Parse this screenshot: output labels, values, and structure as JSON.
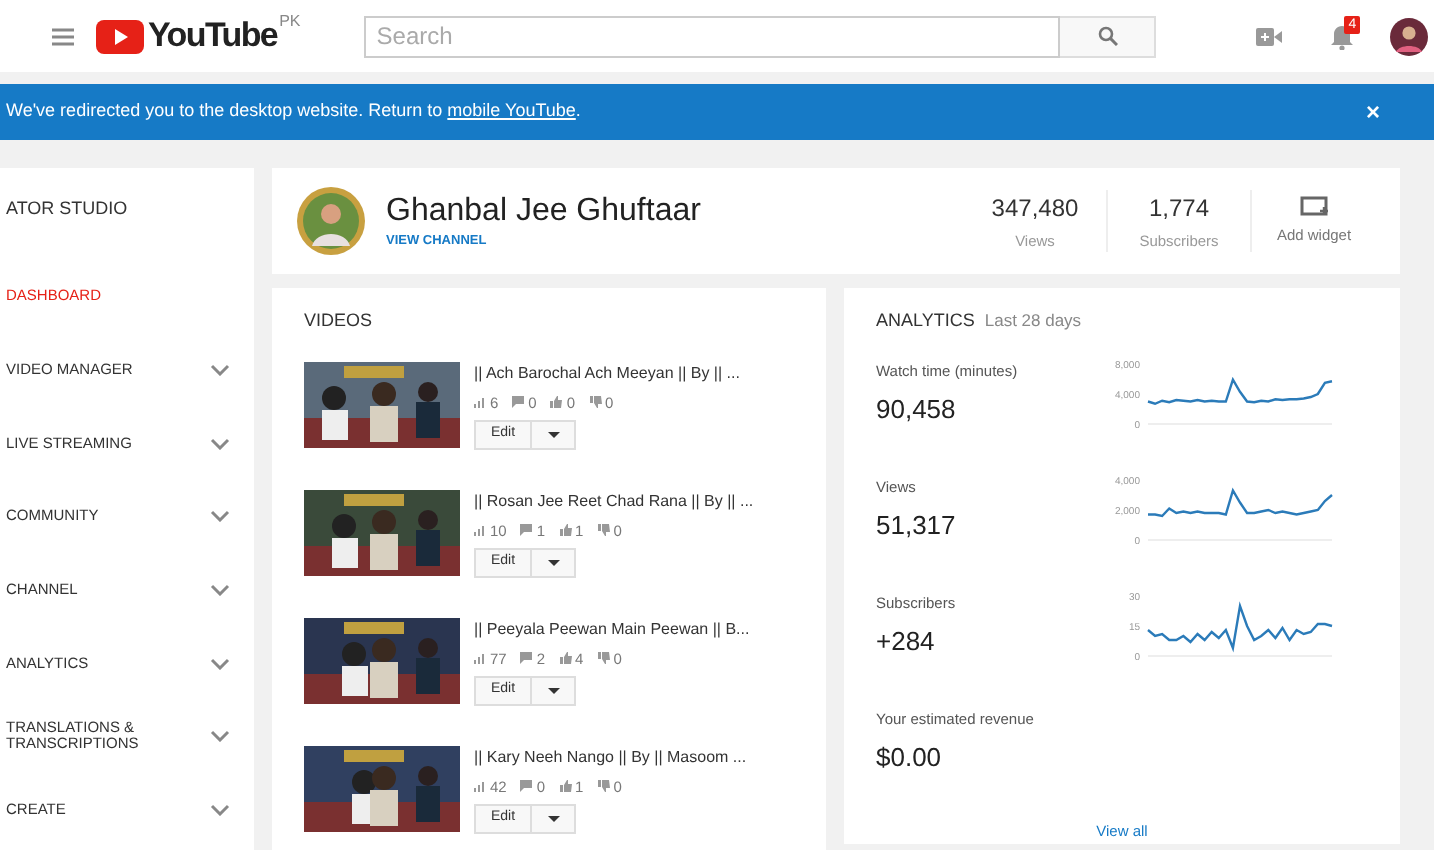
{
  "topbar": {
    "logo": "YouTube",
    "region": "PK",
    "search": {
      "placeholder": "Search"
    },
    "notifications": "4"
  },
  "banner": {
    "text": "We've redirected you to the desktop website. Return to ",
    "link": "mobile YouTube",
    "end": ".",
    "close": "×"
  },
  "sidebar": {
    "title": "ATOR STUDIO",
    "items": [
      {
        "label": "DASHBOARD",
        "selected": true,
        "expandable": false
      },
      {
        "label": "VIDEO MANAGER",
        "selected": false,
        "expandable": true
      },
      {
        "label": "LIVE STREAMING",
        "selected": false,
        "expandable": true
      },
      {
        "label": "COMMUNITY",
        "selected": false,
        "expandable": true
      },
      {
        "label": "CHANNEL",
        "selected": false,
        "expandable": true
      },
      {
        "label": "ANALYTICS",
        "selected": false,
        "expandable": true
      },
      {
        "label": "TRANSLATIONS & TRANSCRIPTIONS",
        "selected": false,
        "expandable": true
      },
      {
        "label": "CREATE",
        "selected": false,
        "expandable": true
      }
    ]
  },
  "channel": {
    "name": "Ghanbal Jee Ghuftaar",
    "link": "VIEW CHANNEL",
    "stats": [
      {
        "value": "347,480",
        "label": "Views"
      },
      {
        "value": "1,774",
        "label": "Subscribers"
      }
    ],
    "add_widget": "Add widget"
  },
  "videos": {
    "title": "VIDEOS",
    "items": [
      {
        "title": "|| Ach Barochal Ach Meeyan || By || ...",
        "views": "6",
        "comments": "0",
        "likes": "0",
        "dislikes": "0",
        "edit": "Edit"
      },
      {
        "title": "|| Rosan Jee Reet Chad Rana || By || ...",
        "views": "10",
        "comments": "1",
        "likes": "1",
        "dislikes": "0",
        "edit": "Edit"
      },
      {
        "title": "|| Peeyala Peewan Main Peewan || B...",
        "views": "77",
        "comments": "2",
        "likes": "4",
        "dislikes": "0",
        "edit": "Edit"
      },
      {
        "title": "|| Kary Neeh Nango || By || Masoom ...",
        "views": "42",
        "comments": "0",
        "likes": "1",
        "dislikes": "0",
        "edit": "Edit"
      }
    ]
  },
  "analytics": {
    "title": "ANALYTICS",
    "period": "Last 28 days",
    "metrics": [
      {
        "label": "Watch time (minutes)",
        "value": "90,458",
        "chart_data": {
          "type": "line",
          "ylim": [
            0,
            8000
          ],
          "yticks": [
            0,
            {
              "value": 4000,
              "label": "4,000"
            },
            {
              "value": 8000,
              "label": "8,000"
            }
          ],
          "series": [
            {
              "color": "#2b7bb9",
              "values": [
                3000,
                2700,
                3100,
                2900,
                3200,
                3100,
                3000,
                3200,
                3000,
                3100,
                3000,
                3000,
                5900,
                4300,
                3000,
                2900,
                3100,
                3000,
                3300,
                3200,
                3300,
                3300,
                3400,
                3600,
                4000,
                5500,
                5700
              ]
            }
          ]
        }
      },
      {
        "label": "Views",
        "value": "51,317",
        "chart_data": {
          "type": "line",
          "ylim": [
            0,
            4000
          ],
          "yticks": [
            0,
            {
              "value": 2000,
              "label": "2,000"
            },
            {
              "value": 4000,
              "label": "4,000"
            }
          ],
          "series": [
            {
              "color": "#2b7bb9",
              "values": [
                1700,
                1700,
                1600,
                2100,
                1800,
                1900,
                1800,
                1900,
                1800,
                1800,
                1800,
                1700,
                3300,
                2500,
                1800,
                1800,
                1900,
                2000,
                1800,
                1900,
                1800,
                1700,
                1800,
                1900,
                2000,
                2600,
                3000
              ]
            }
          ]
        }
      },
      {
        "label": "Subscribers",
        "value": "+284",
        "chart_data": {
          "type": "line",
          "ylim": [
            0,
            30
          ],
          "yticks": [
            0,
            15,
            30
          ],
          "series": [
            {
              "color": "#2b7bb9",
              "values": [
                13,
                10,
                11,
                8,
                8,
                10,
                7,
                11,
                8,
                12,
                9,
                13,
                4,
                25,
                15,
                8,
                10,
                13,
                9,
                14,
                8,
                13,
                11,
                12,
                16,
                16,
                15
              ]
            }
          ]
        }
      },
      {
        "label": "Your estimated revenue",
        "value": "$0.00"
      }
    ],
    "view_all": "View all"
  }
}
